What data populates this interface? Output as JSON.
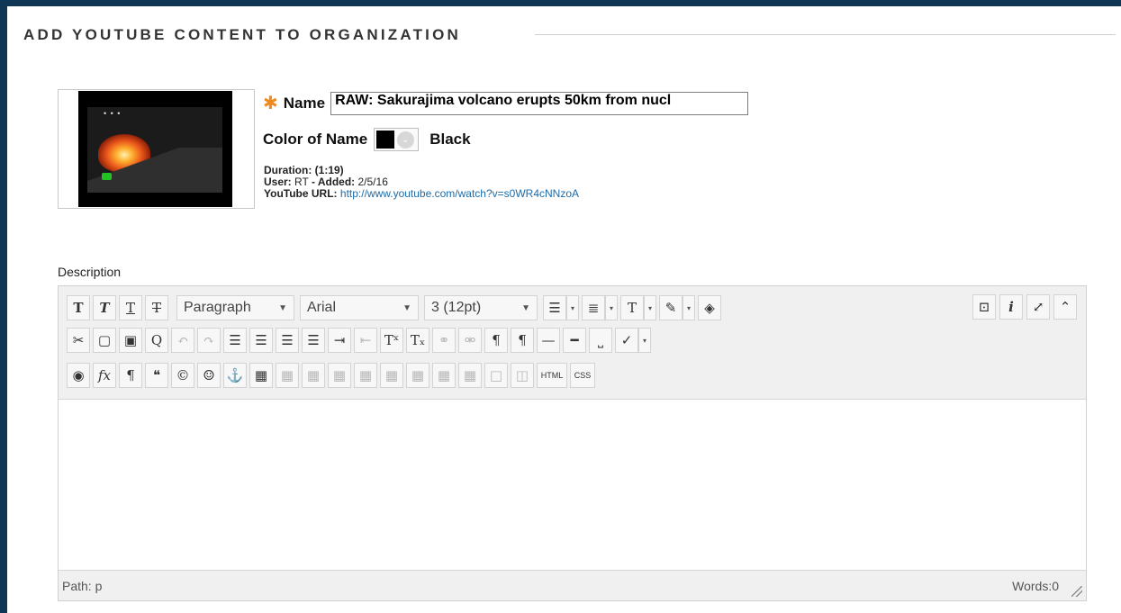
{
  "header": {
    "title": "ADD YOUTUBE CONTENT TO ORGANIZATION"
  },
  "video": {
    "name_label": "Name",
    "name_value": "RAW: Sakurajima volcano erupts 50km from nucl",
    "color_label": "Color of Name",
    "color_value": "Black",
    "color_hex": "#000000",
    "duration_label": "Duration:",
    "duration_value": "(1:19)",
    "user_label": "User:",
    "user_value": "RT",
    "added_label": "- Added:",
    "added_value": "2/5/16",
    "url_label": "YouTube URL:",
    "url_value": "http://www.youtube.com/watch?v=s0WR4cNNzoA"
  },
  "description": {
    "label": "Description",
    "format_select": "Paragraph",
    "font_select": "Arial",
    "size_select": "3 (12pt)",
    "html_btn": "HTML",
    "css_btn": "CSS",
    "path": "Path: p",
    "words": "Words:0"
  },
  "colors": {
    "accent": "#0f3655",
    "required_star": "#f08a1b",
    "link": "#1e6ba8"
  }
}
